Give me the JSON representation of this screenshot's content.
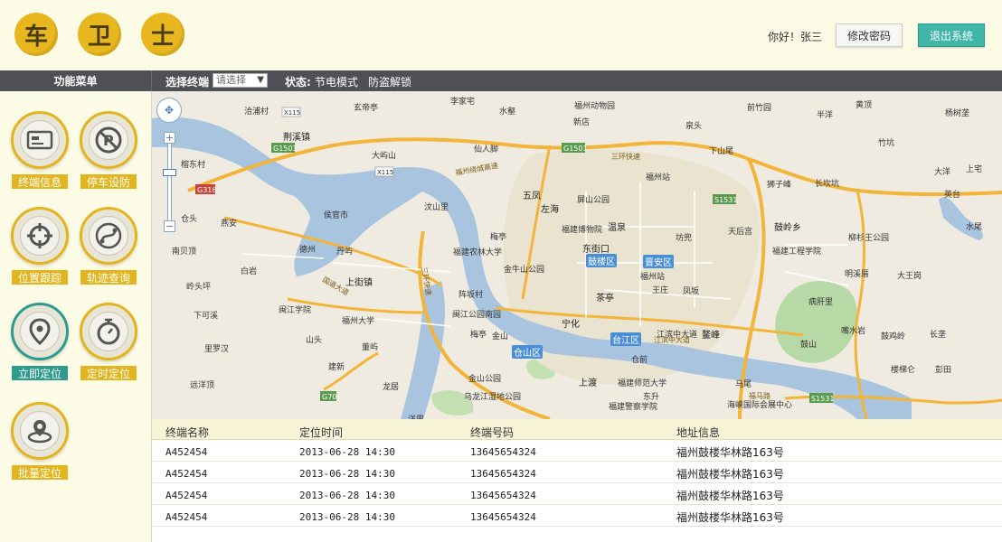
{
  "logo": {
    "chars": [
      "车",
      "卫",
      "士"
    ]
  },
  "header": {
    "greeting": "你好！张三",
    "change_password": "修改密码",
    "logout": "退出系统"
  },
  "topbar": {
    "menu_title": "功能菜单",
    "terminal_label": "选择终端",
    "terminal_select": "请选择",
    "status_label": "状态:",
    "status_links": [
      "节电模式",
      "防盗解锁"
    ]
  },
  "sidebar": {
    "items": [
      {
        "label": "终端信息",
        "icon": "terminal-icon"
      },
      {
        "label": "停车设防",
        "icon": "no-parking-icon"
      },
      {
        "label": "位置跟踪",
        "icon": "crosshair-icon"
      },
      {
        "label": "轨迹查询",
        "icon": "track-icon"
      },
      {
        "label": "立即定位",
        "icon": "location-pin-icon"
      },
      {
        "label": "定时定位",
        "icon": "stopwatch-icon"
      },
      {
        "label": "批量定位",
        "icon": "batch-location-icon"
      }
    ],
    "active_index": 4
  },
  "map": {
    "labels": [
      "洽浦村",
      "玄帝亭",
      "李家宅",
      "水壑",
      "福州动物园",
      "新店",
      "前竹园",
      "半洋",
      "黄顶",
      "杨树垄",
      "荆溪镇",
      "仙人脚",
      "泉头",
      "下山尾",
      "竹坑",
      "上宅",
      "大屿山",
      "福州站",
      "狮子峰",
      "长坎坑",
      "大洋",
      "英台",
      "榕东村",
      "五凤",
      "屏山公园",
      "侯官市",
      "汶山里",
      "左海",
      "福建博物院",
      "温泉",
      "坊兜",
      "天后宫",
      "鼓岭乡",
      "柳杉王公园",
      "水尾",
      "仓头",
      "燕安",
      "梅亭",
      "福建农林大学",
      "东街口",
      "福建工程学院",
      "明溪厝",
      "南贝顶",
      "德州",
      "丹屿",
      "金牛山公园",
      "福州站",
      "白岩",
      "岭头坪",
      "上街镇",
      "阵坂村",
      "茶亭",
      "王庄",
      "凤坂",
      "大王岗",
      "闽江学院",
      "下可溪",
      "福州大学",
      "闽江公园南园",
      "宁化",
      "鳌峰",
      "病肝里",
      "嘴水岩",
      "长垄",
      "山头",
      "梅亭",
      "金山",
      "江滨中大道",
      "鼓山",
      "鼓鸡岭",
      "里罗汉",
      "董屿",
      "仓山区",
      "仓前",
      "建新",
      "金山公园",
      "上渡",
      "福建师范大学",
      "楼梯仑",
      "彭田",
      "远洋顶",
      "龙居",
      "福建警察学院",
      "东升",
      "海峡国际会展中心",
      "乌龙江湿地公园",
      "马尾",
      "洋里"
    ],
    "districts": [
      "鼓楼区",
      "晋安区",
      "台江区",
      "仓山区"
    ],
    "roads": [
      "G1501",
      "G316",
      "X115",
      "S1531",
      "G70",
      "福州绕城高速",
      "三环快速",
      "国道大道"
    ]
  },
  "table": {
    "headers": [
      "终端名称",
      "定位时间",
      "终端号码",
      "地址信息"
    ],
    "rows": [
      [
        "A452454",
        "2013-06-28 14:30",
        "13645654324",
        "福州鼓楼华林路163号"
      ],
      [
        "A452454",
        "2013-06-28 14:30",
        "13645654324",
        "福州鼓楼华林路163号"
      ],
      [
        "A452454",
        "2013-06-28 14:30",
        "13645654324",
        "福州鼓楼华林路163号"
      ],
      [
        "A452454",
        "2013-06-28 14:30",
        "13645654324",
        "福州鼓楼华林路163号"
      ]
    ]
  },
  "colors": {
    "accent": "#e2b41e",
    "active": "#2e9b8e",
    "topbar": "#4e5055",
    "water": "#9fb9d6"
  }
}
